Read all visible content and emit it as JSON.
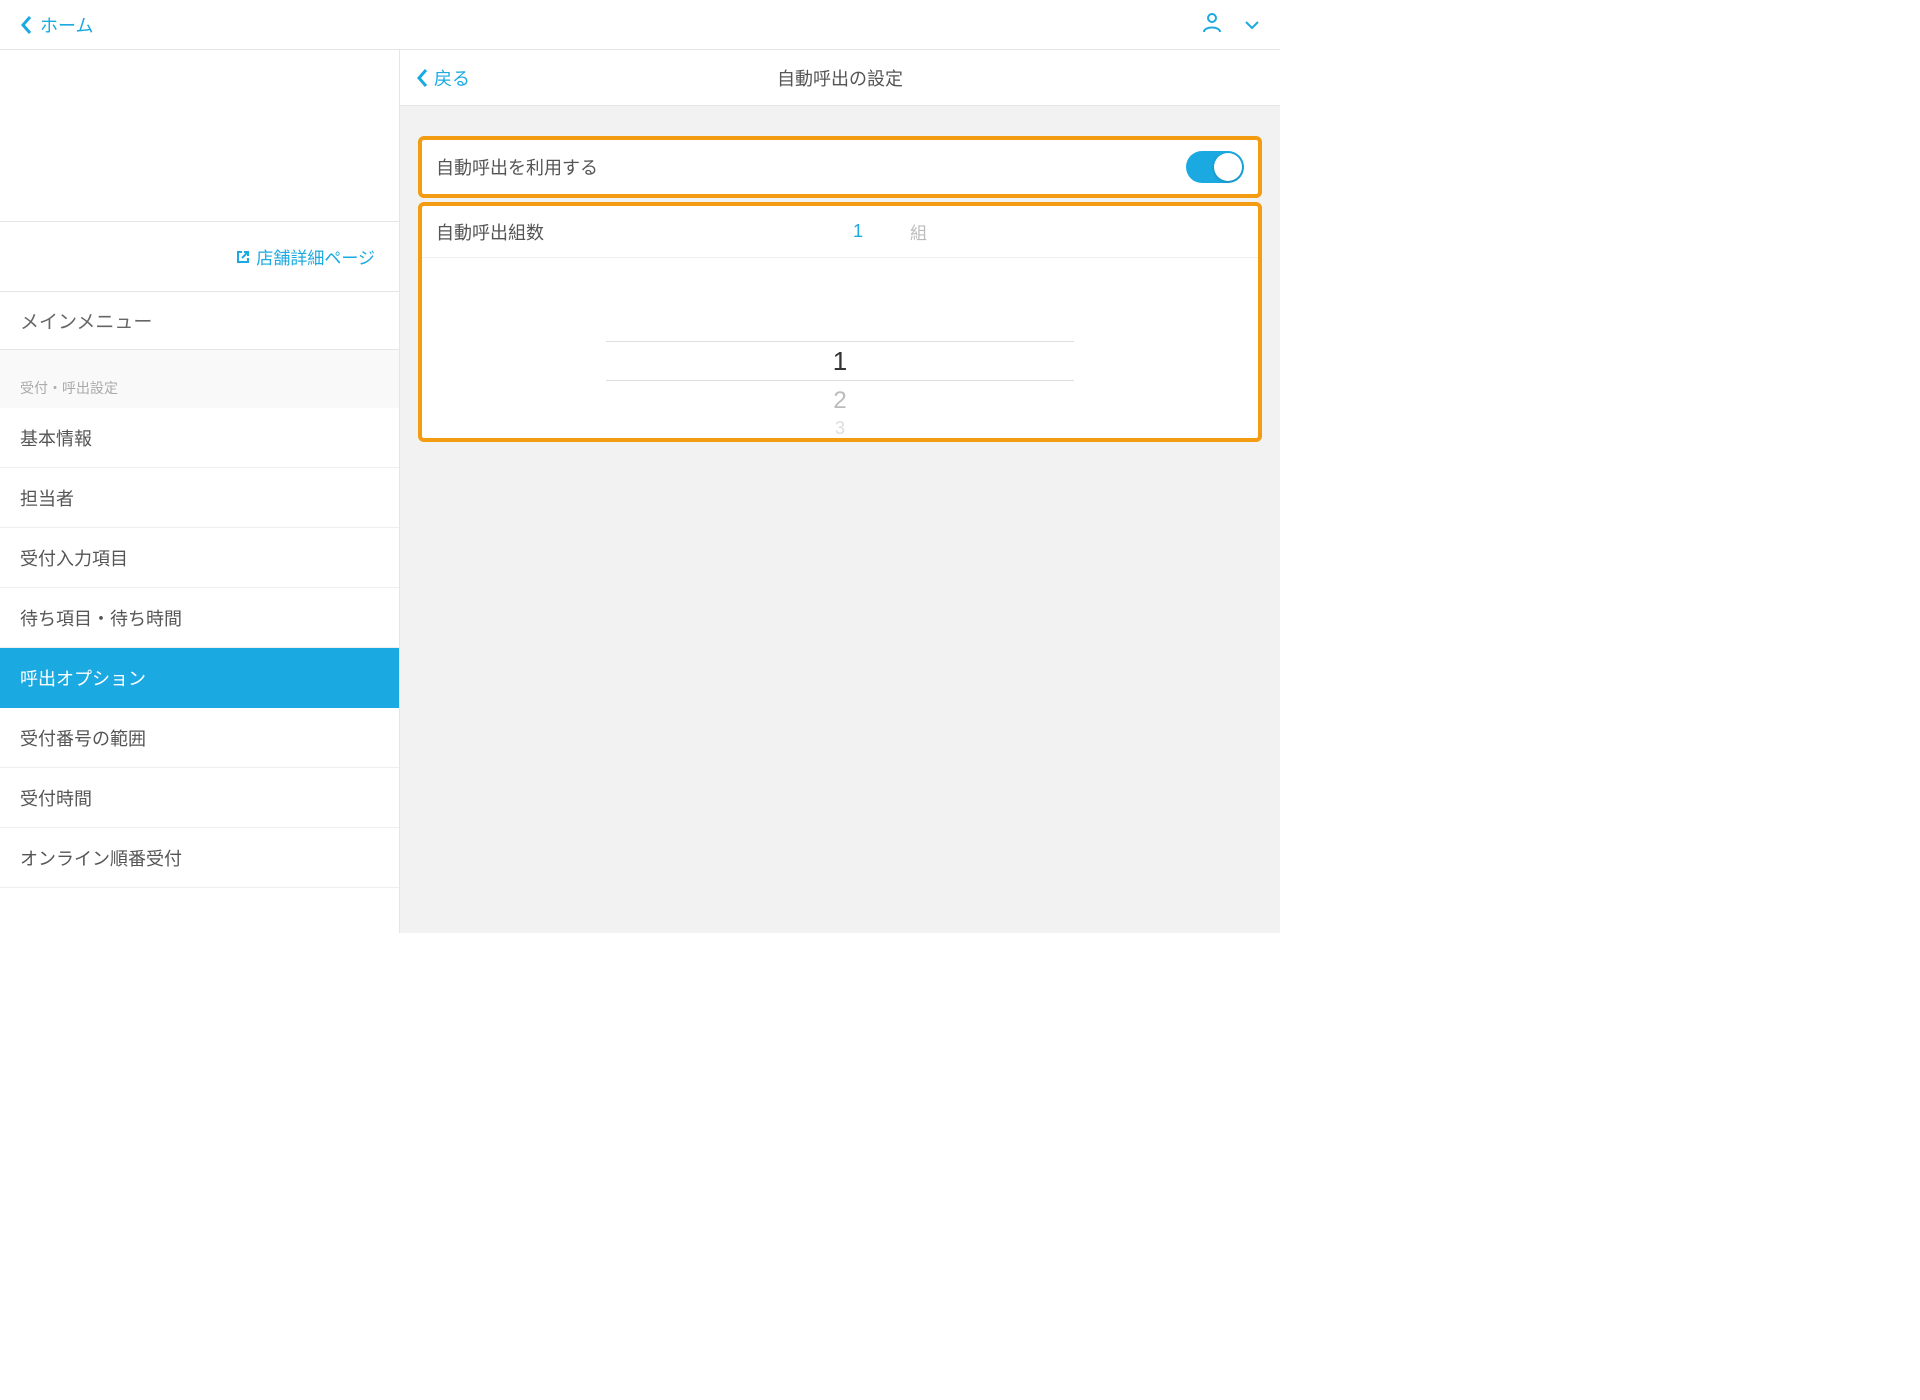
{
  "header": {
    "home_label": "ホーム"
  },
  "sidebar": {
    "store_link_label": "店舗詳細ページ",
    "main_menu_label": "メインメニュー",
    "group_label": "受付・呼出設定",
    "items": [
      {
        "label": "基本情報",
        "active": false
      },
      {
        "label": "担当者",
        "active": false
      },
      {
        "label": "受付入力項目",
        "active": false
      },
      {
        "label": "待ち項目・待ち時間",
        "active": false
      },
      {
        "label": "呼出オプション",
        "active": true
      },
      {
        "label": "受付番号の範囲",
        "active": false
      },
      {
        "label": "受付時間",
        "active": false
      },
      {
        "label": "オンライン順番受付",
        "active": false
      }
    ]
  },
  "content": {
    "back_label": "戻る",
    "title": "自動呼出の設定",
    "toggle_row": {
      "label": "自動呼出を利用する",
      "enabled": true
    },
    "number_row": {
      "label": "自動呼出組数",
      "value": "1",
      "unit": "組"
    },
    "picker": {
      "selected": "1",
      "next": "2",
      "faded": "3"
    }
  }
}
